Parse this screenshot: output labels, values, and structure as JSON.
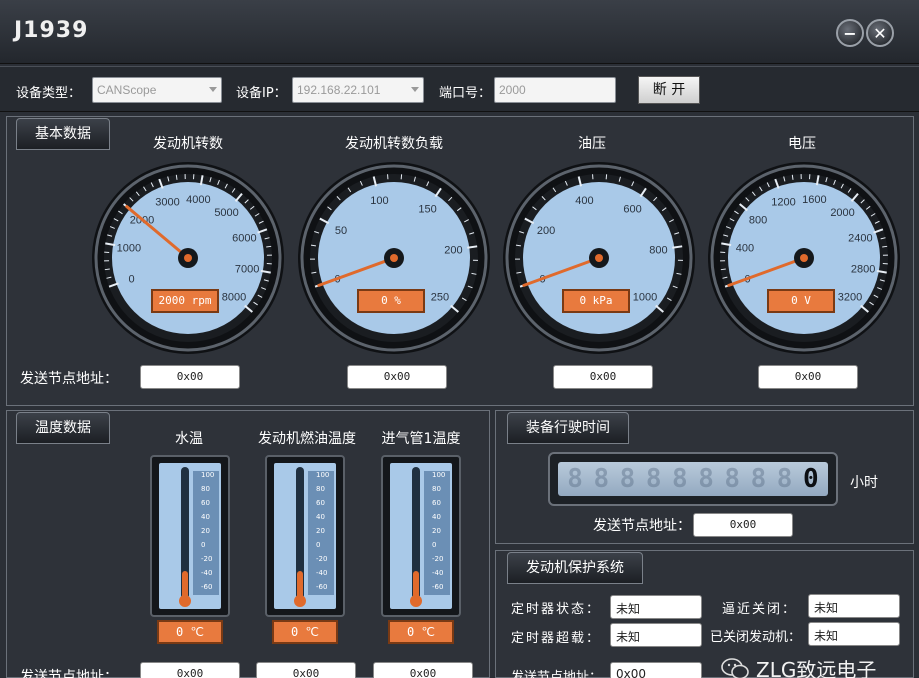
{
  "window": {
    "title": "J1939"
  },
  "toolbar": {
    "device_type_label": "设备类型：",
    "device_type_value": "CANScope",
    "device_ip_label": "设备IP：",
    "device_ip_value": "192.168.22.101",
    "port_label": "端口号：",
    "port_value": "2000",
    "disconnect_label": "断 开"
  },
  "basic": {
    "tab": "基本数据",
    "address_label": "发送节点地址：",
    "gauges": [
      {
        "title": "发动机转数",
        "ticks": [
          "0",
          "1000",
          "2000",
          "3000",
          "4000",
          "5000",
          "6000",
          "7000",
          "8000"
        ],
        "readout": "2000 rpm",
        "value_fraction": 0.25,
        "address": "0x00"
      },
      {
        "title": "发动机转数负载",
        "ticks": [
          "0",
          "50",
          "100",
          "150",
          "200",
          "250"
        ],
        "readout": "0 %",
        "value_fraction": 0.0,
        "address": "0x00"
      },
      {
        "title": "油压",
        "ticks": [
          "0",
          "200",
          "400",
          "600",
          "800",
          "1000"
        ],
        "readout": "0 kPa",
        "value_fraction": 0.0,
        "address": "0x00"
      },
      {
        "title": "电压",
        "ticks": [
          "0",
          "400",
          "800",
          "1200",
          "1600",
          "2000",
          "2400",
          "2800",
          "3200"
        ],
        "readout": "0 V",
        "value_fraction": 0.0,
        "address": "0x00"
      }
    ]
  },
  "temperature": {
    "tab": "温度数据",
    "address_label": "发送节点地址：",
    "scale": [
      "100",
      "80",
      "60",
      "40",
      "20",
      "0",
      "-20",
      "-40",
      "-60"
    ],
    "items": [
      {
        "title": "水温",
        "readout": "0 ℃",
        "address": "0x00"
      },
      {
        "title": "发动机燃油温度",
        "readout": "0 ℃",
        "address": "0x00"
      },
      {
        "title": "进气管1温度",
        "readout": "0 ℃",
        "address": "0x00"
      }
    ]
  },
  "runtime": {
    "tab": "装备行驶时间",
    "digits": [
      "8",
      "8",
      "8",
      "8",
      "8",
      "8",
      "8",
      "8",
      "8",
      "0"
    ],
    "unit": "小时",
    "address_label": "发送节点地址：",
    "address": "0x00"
  },
  "protection": {
    "tab": "发动机保护系统",
    "timer_state_label": "定时器状态：",
    "timer_state_value": "未知",
    "approach_close_label": "逼近关闭：",
    "approach_close_value": "未知",
    "timer_overload_label": "定时器超载：",
    "timer_overload_value": "未知",
    "engine_off_label": "已关闭发动机：",
    "engine_off_value": "未知",
    "address_label": "发送节点地址：",
    "address": "0x00"
  },
  "watermark": {
    "text": "ZLG致远电子"
  },
  "colors": {
    "accent": "#e87a3e",
    "gauge_face": "#a9c9e8",
    "background": "#2b2f36"
  }
}
